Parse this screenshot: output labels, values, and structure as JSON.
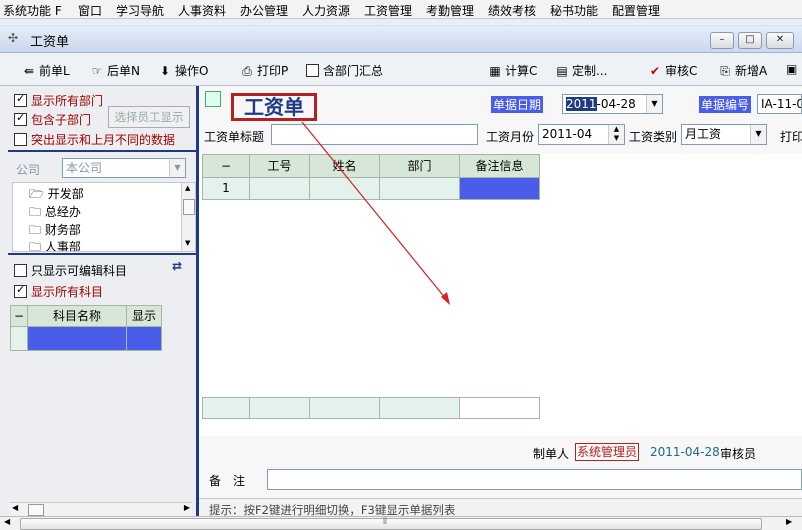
{
  "menu": [
    "系统功能 F",
    "窗口",
    "学习导航",
    "人事资料",
    "办公管理",
    "人力资源",
    "工资管理",
    "考勤管理",
    "绩效考核",
    "秘书功能",
    "配置管理"
  ],
  "window": {
    "title": "工资单",
    "min": "–",
    "max": "□",
    "close": "✕"
  },
  "toolbar": {
    "prev": "前单L",
    "next": "后单N",
    "ops": "操作O",
    "print": "打印P",
    "all_dept": "含部门汇总",
    "calc": "计算C",
    "custom": "定制...",
    "audit": "审核C",
    "add": "新增A"
  },
  "left": {
    "show_all_dept": "显示所有部门",
    "include_sub": "包含子部门",
    "select_employee": "选择员工显示",
    "highlight_diff": "突出显示和上月不同的数据",
    "company_label": "公司",
    "company_value": "本公司",
    "depts": [
      "开发部",
      "总经办",
      "财务部",
      "人事部"
    ],
    "only_editable": "只显示可编辑科目",
    "show_all_subjects": "显示所有科目",
    "subject_col_minus": "−",
    "subject_col_name": "科目名称",
    "subject_col_show": "显示"
  },
  "form": {
    "heading": "工资单",
    "date_label": "单据日期",
    "date_value_sel": "2011",
    "date_value_rest": "-04-28",
    "no_label": "单据编号",
    "no_value": "IA-11-0",
    "title_label": "工资单标题",
    "title_value": "",
    "month_label": "工资月份",
    "month_value": "2011-04",
    "type_label": "工资类别",
    "type_value": "月工资",
    "print_label": "打印"
  },
  "grid": {
    "cols": [
      "−",
      "工号",
      "姓名",
      "部门",
      "备注信息"
    ],
    "rows": [
      [
        "1",
        "",
        "",
        "",
        ""
      ]
    ]
  },
  "footer": {
    "maker_label": "制单人",
    "maker_value": "系统管理员",
    "date": "2011-04-28",
    "auditor_label": "审核员",
    "remark_label": "备　注",
    "hint": "提示：按F2键进行明细切换，F3键显示单据列表"
  },
  "colors": {
    "accent_red": "#b22222",
    "selection_blue": "#4a5de8",
    "navy": "#1f3a84",
    "arrow": "#d42020"
  }
}
